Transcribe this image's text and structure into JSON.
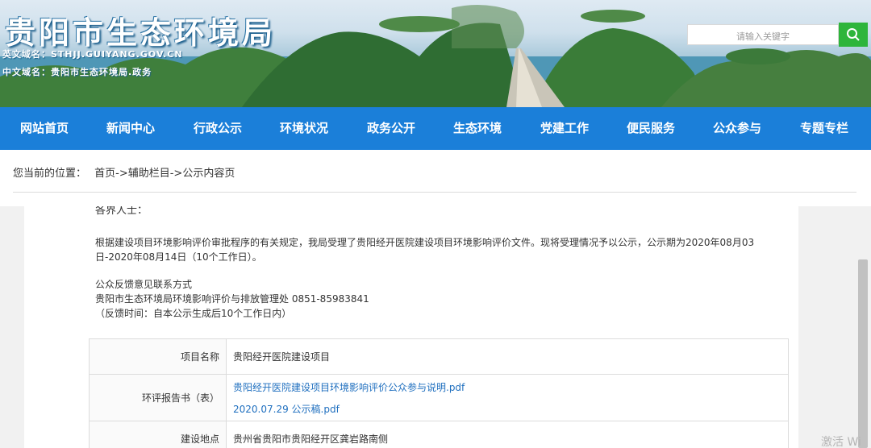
{
  "header": {
    "site_title": "贵阳市生态环境局",
    "domain_en": "英文域名：STHJJ.GUIYANG.GOV.CN",
    "domain_cn": "中文域名：贵阳市生态环境局.政务",
    "search": {
      "placeholder": "请输入关键字"
    }
  },
  "nav": {
    "items": [
      {
        "label": "网站首页"
      },
      {
        "label": "新闻中心"
      },
      {
        "label": "行政公示"
      },
      {
        "label": "环境状况"
      },
      {
        "label": "政务公开"
      },
      {
        "label": "生态环境"
      },
      {
        "label": "党建工作"
      },
      {
        "label": "便民服务"
      },
      {
        "label": "公众参与"
      },
      {
        "label": "专题专栏"
      }
    ]
  },
  "breadcrumb": {
    "prefix": "您当前的位置：",
    "path": "首页->辅助栏目->公示内容页"
  },
  "content": {
    "cut_line": "各界人士：",
    "paragraph1": "根据建设项目环境影响评价审批程序的有关规定，我局受理了贵阳经开医院建设项目环境影响评价文件。现将受理情况予以公示，公示期为2020年08月03日-2020年08月14日（10个工作日）。",
    "contact_title": "公众反馈意见联系方式",
    "contact_line": "贵阳市生态环境局环境影响评价与排放管理处 0851-85983841",
    "contact_note": "（反馈时间：自本公示生成后10个工作日内）",
    "table": {
      "project_name_label": "项目名称",
      "project_name": "贵阳经开医院建设项目",
      "report_label": "环评报告书（表）",
      "report_link1": "贵阳经开医院建设项目环境影响评价公众参与说明.pdf",
      "report_link2": "2020.07.29 公示稿.pdf",
      "location_label": "建设地点",
      "location": "贵州省贵阳市贵阳经开区龚岩路南侧"
    }
  },
  "watermark": "激活 Wi",
  "colors": {
    "nav_bg": "#1b7fd9",
    "search_button": "#2eb53b",
    "link": "#1f6fbf"
  },
  "icons": {
    "search": "search-icon"
  }
}
